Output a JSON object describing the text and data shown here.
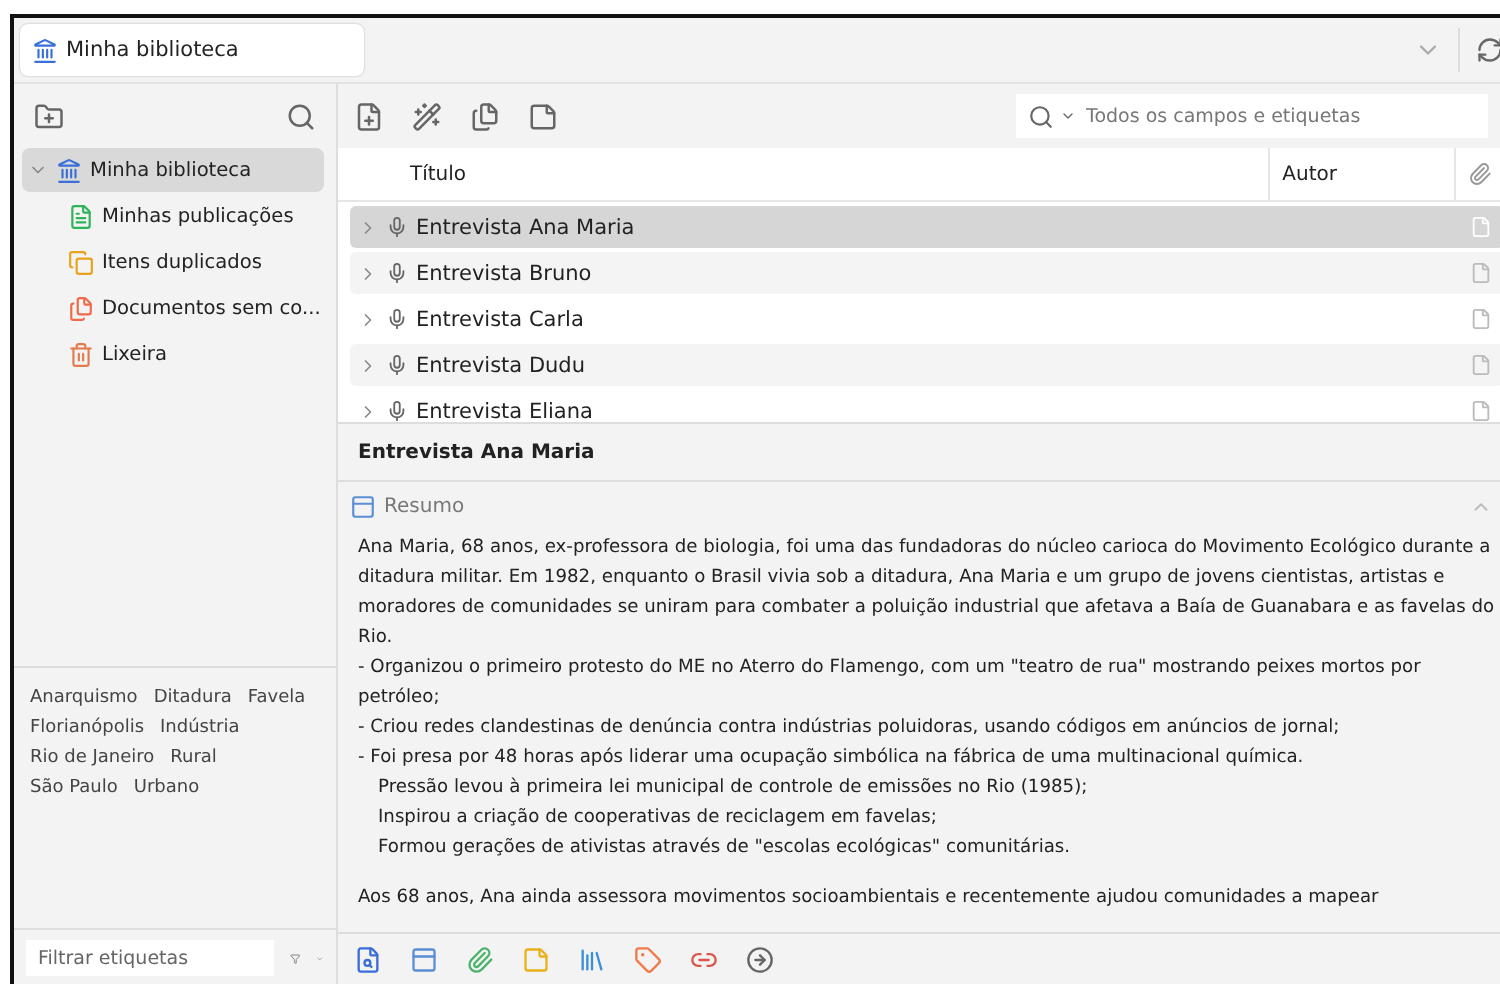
{
  "library_tab": {
    "label": "Minha biblioteca"
  },
  "collections": [
    {
      "label": "Minha biblioteca",
      "kind": "library",
      "selected": true,
      "expanded": true,
      "children": [
        {
          "label": "Minhas publicações",
          "kind": "publications",
          "selected": false
        },
        {
          "label": "Itens duplicados",
          "kind": "duplicates",
          "selected": false
        },
        {
          "label": "Documentos sem co...",
          "kind": "unfiled",
          "selected": false
        },
        {
          "label": "Lixeira",
          "kind": "trash",
          "selected": false
        }
      ]
    }
  ],
  "tags": [
    "Anarquismo",
    "Ditadura",
    "Favela",
    "Florianópolis",
    "Indústria",
    "Rio de Janeiro",
    "Rural",
    "São Paulo",
    "Urbano"
  ],
  "tag_filter": {
    "placeholder": "Filtrar etiquetas"
  },
  "search": {
    "placeholder": "Todos os campos e etiquetas"
  },
  "table": {
    "columns": [
      "Título",
      "Autor"
    ],
    "rows": [
      {
        "title": "Entrevista Ana Maria",
        "selected": true
      },
      {
        "title": "Entrevista Bruno",
        "selected": false
      },
      {
        "title": "Entrevista Carla",
        "selected": false
      },
      {
        "title": "Entrevista Dudu",
        "selected": false
      },
      {
        "title": "Entrevista Eliana",
        "selected": false
      }
    ]
  },
  "item_pane": {
    "title": "Entrevista Ana Maria",
    "section": "Resumo",
    "abstract": [
      {
        "text": "Ana Maria, 68 anos, ex-professora de biologia, foi uma das fundadoras do núcleo carioca do Movimento Ecológico durante a ditadura militar. Em 1982, enquanto o Brasil vivia sob a ditadura, Ana Maria e um grupo de jovens cientistas, artistas e moradores de comunidades se uniram para combater a poluição industrial que afetava a Baía de Guanabara e as favelas do Rio.",
        "kind": "paragraph"
      },
      {
        "text": "- Organizou o primeiro protesto do ME no Aterro do Flamengo, com um \"teatro de rua\" mostrando peixes mortos por petróleo;",
        "kind": "paragraph"
      },
      {
        "text": "- Criou redes clandestinas de denúncia contra indústrias poluidoras, usando códigos em anúncios de jornal;",
        "kind": "paragraph"
      },
      {
        "text": "- Foi presa por 48 horas após liderar uma ocupação simbólica na fábrica de uma multinacional química.",
        "kind": "paragraph"
      },
      {
        "text": "Pressão levou à primeira lei municipal de controle de emissões no Rio (1985);",
        "kind": "indented"
      },
      {
        "text": "Inspirou a criação de cooperativas de reciclagem em favelas;",
        "kind": "indented"
      },
      {
        "text": "Formou gerações de ativistas através de \"escolas ecológicas\" comunitárias.",
        "kind": "indented"
      },
      {
        "text": "Aos 68 anos, Ana ainda assessora movimentos socioambientais e recentemente ajudou comunidades a mapear",
        "kind": "gap"
      }
    ]
  }
}
